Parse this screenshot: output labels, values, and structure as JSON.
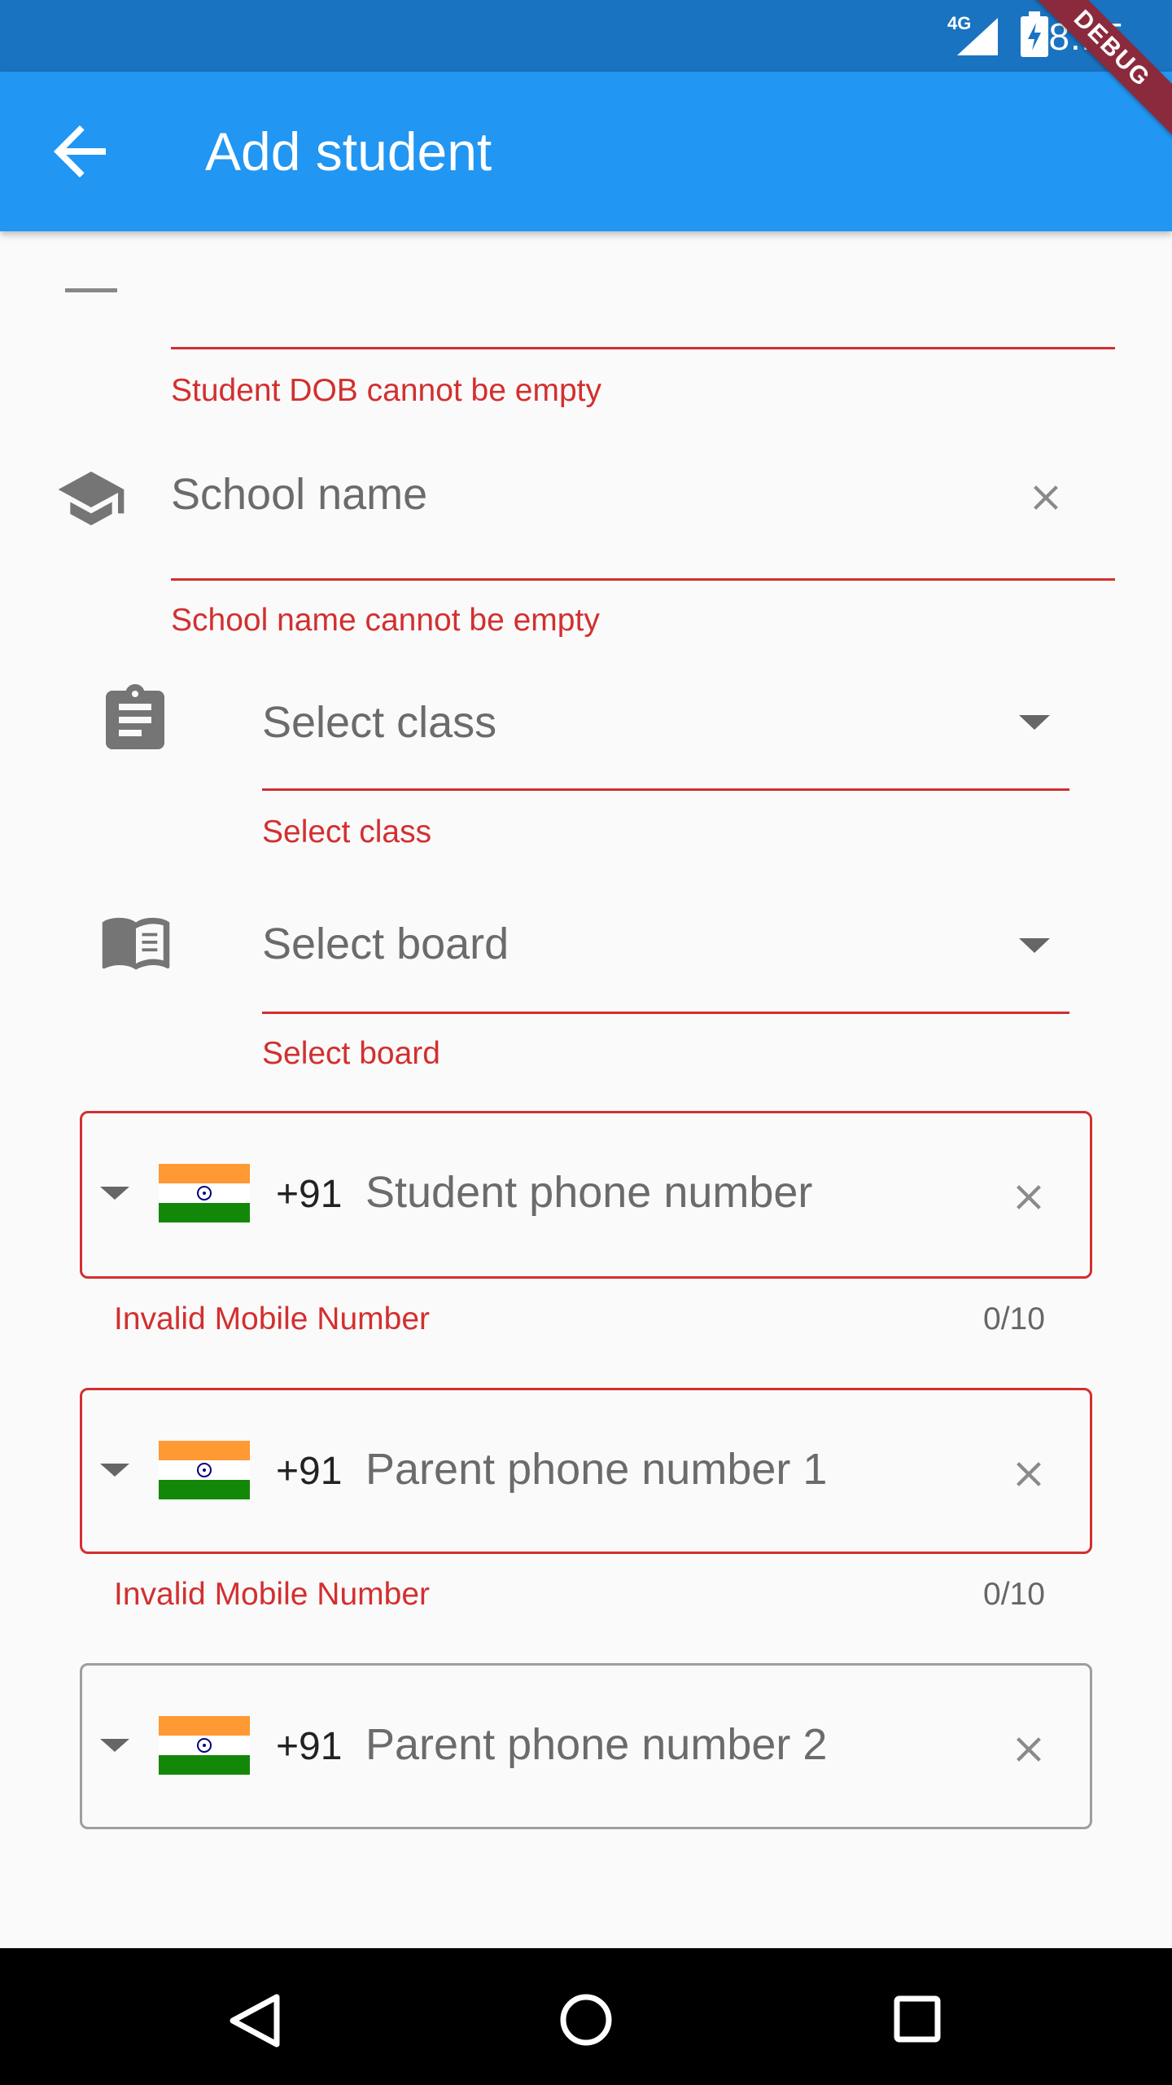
{
  "status_bar": {
    "network": "4G",
    "time": "8:15",
    "debug_label": "DEBUG"
  },
  "app_bar": {
    "title": "Add student",
    "back_icon": "arrow-back-icon"
  },
  "dob": {
    "error": "Student DOB cannot be empty"
  },
  "school": {
    "placeholder": "School name",
    "error": "School name cannot be empty",
    "icon": "school-icon"
  },
  "class_select": {
    "placeholder": "Select class",
    "error": "Select class",
    "icon": "assignment-icon"
  },
  "board_select": {
    "placeholder": "Select board",
    "error": "Select board",
    "icon": "book-icon"
  },
  "phones": [
    {
      "code": "+91",
      "placeholder": "Student phone number",
      "error": "Invalid Mobile Number",
      "counter": "0/10"
    },
    {
      "code": "+91",
      "placeholder": "Parent phone number 1",
      "error": "Invalid Mobile Number",
      "counter": "0/10"
    },
    {
      "code": "+91",
      "placeholder": "Parent phone number 2"
    }
  ],
  "colors": {
    "primary": "#2196f3",
    "status_bar": "#1a73c0",
    "error": "#d32f2f",
    "saffron": "#ff9933",
    "green": "#138808"
  }
}
